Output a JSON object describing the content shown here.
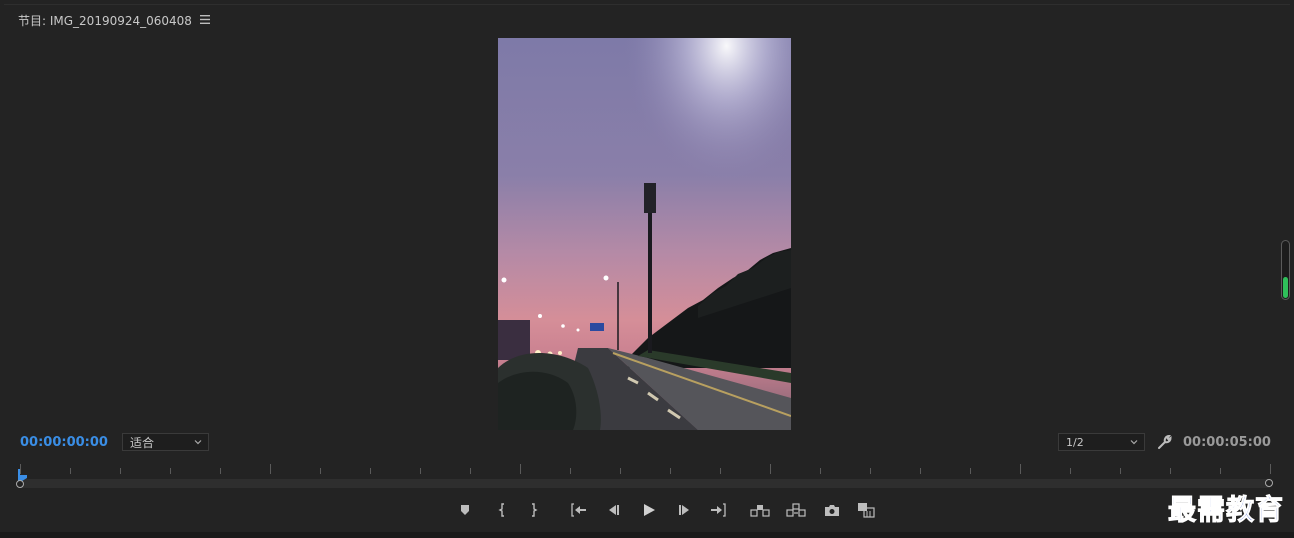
{
  "panel": {
    "title": "节目: IMG_20190924_060408",
    "menu_icon": "hamburger-icon"
  },
  "monitor": {
    "current_timecode": "00:00:00:00",
    "duration_timecode": "00:00:05:00",
    "zoom_value": "适合",
    "resolution_value": "1/2",
    "audio_level": 0.4
  },
  "colors": {
    "timecode_accent": "#3a8ee6",
    "meter_green": "#2fbf5a",
    "panel_bg": "#232323"
  },
  "transport_icons": [
    "add-marker-icon",
    "mark-in-icon",
    "mark-out-icon",
    "go-to-in-icon",
    "step-back-icon",
    "play-icon",
    "step-forward-icon",
    "go-to-out-icon",
    "lift-icon",
    "extract-icon",
    "export-frame-icon",
    "compare-view-icon"
  ],
  "watermark": {
    "text": "最需教育"
  }
}
